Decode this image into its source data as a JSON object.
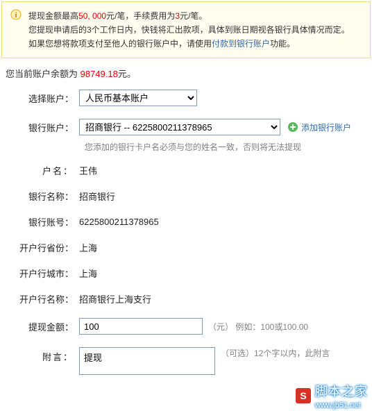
{
  "notice": {
    "line1_prefix": "提现金额最高",
    "line1_limit": "50, 000",
    "line1_mid": "元/笔，手续费用为",
    "line1_fee": "3",
    "line1_suffix": "元/笔。",
    "line2": "您提现申请后的3个工作日内，快钱将汇出款项，具体到账日期视各银行具体情况而定。",
    "line3_prefix": "如果您想将款项支付至他人的银行账户中，请使用",
    "line3_link": "付款到银行账户",
    "line3_suffix": "功能。"
  },
  "balance": {
    "prefix": "您当前账户余额为 ",
    "amount": "98749.18",
    "suffix": "元。"
  },
  "labels": {
    "select_account": "选择账户：",
    "bank_account": "银行账户：",
    "add_bank": "添加银行账户",
    "hint_name": "您添加的银行卡户名必须与您的姓名一致，否则将无法提现",
    "owner_name": "户名：",
    "bank_name": "银行名称：",
    "bank_no": "银行账号：",
    "province": "开户行省份：",
    "city": "开户行城市：",
    "branch": "开户行名称：",
    "amount": "提现金额：",
    "amount_hint": "（元） 例如：100或100.00",
    "message": "附言：",
    "message_hint": "（可选）12个字以内，此附言"
  },
  "selects": {
    "account_option": "人民币基本账户",
    "bank_option": "招商银行  -- 6225800211378965"
  },
  "details": {
    "owner_name": "王伟",
    "bank_name": "招商银行",
    "bank_no": "6225800211378965",
    "province": "上海",
    "city": "上海",
    "branch": "招商银行上海支行"
  },
  "inputs": {
    "amount_value": "100",
    "message_value": "提现"
  },
  "watermark": {
    "badge_letter": "S",
    "name": "脚本之家",
    "url": "www.jb51.net"
  }
}
